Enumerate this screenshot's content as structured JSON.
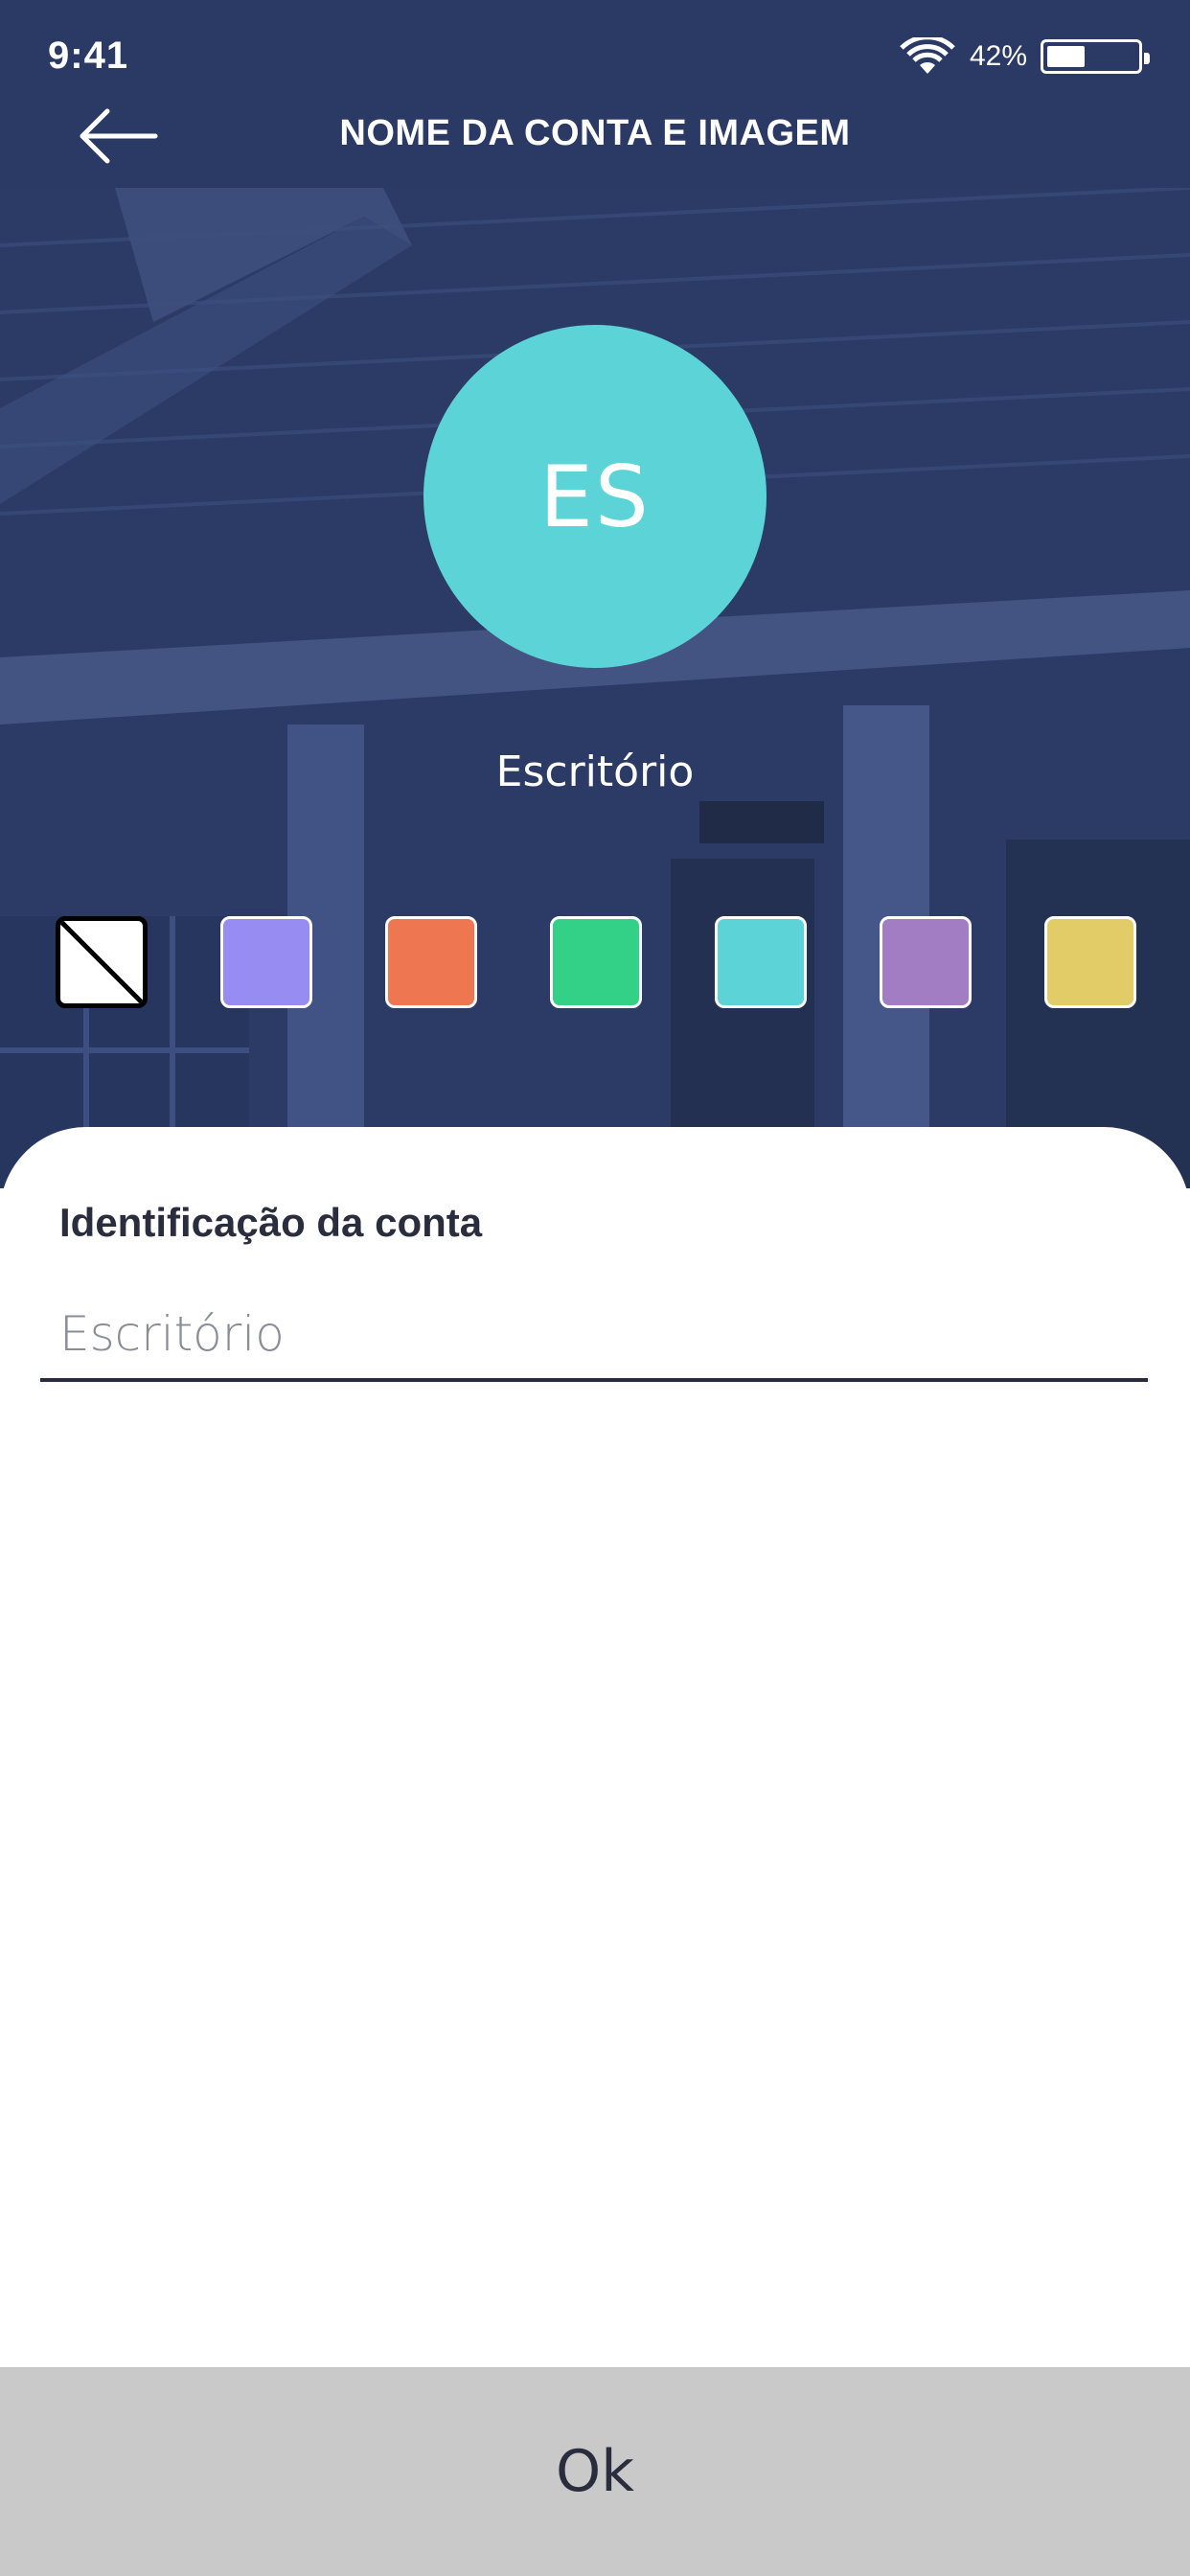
{
  "status_bar": {
    "time": "9:41",
    "battery_percent": "42%",
    "battery_level": 0.42
  },
  "header": {
    "title": "NOME DA CONTA E IMAGEM",
    "back_icon": "arrow-left-icon"
  },
  "avatar": {
    "initials": "ES",
    "color": "#5CD3D6"
  },
  "account_name": "Escritório",
  "colors": [
    {
      "name": "none",
      "hex": "#FFFFFF"
    },
    {
      "name": "lavender",
      "hex": "#968CF2"
    },
    {
      "name": "coral",
      "hex": "#EE7752"
    },
    {
      "name": "green",
      "hex": "#33D087"
    },
    {
      "name": "turquoise",
      "hex": "#5CD3D6"
    },
    {
      "name": "purple",
      "hex": "#A27DC4"
    },
    {
      "name": "yellow",
      "hex": "#E2CC68"
    }
  ],
  "form": {
    "label": "Identificação da conta",
    "placeholder": "Escritório",
    "value": ""
  },
  "ok_button": {
    "label": "Ok"
  }
}
